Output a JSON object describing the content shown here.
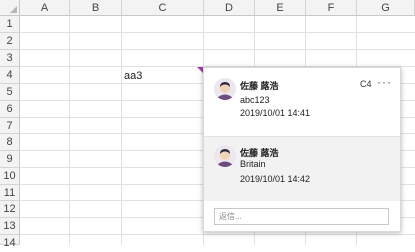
{
  "columns": [
    "A",
    "B",
    "C",
    "D",
    "E",
    "F",
    "G"
  ],
  "rows": [
    "1",
    "2",
    "3",
    "4",
    "5",
    "6",
    "7",
    "8",
    "9",
    "10",
    "11",
    "12",
    "13",
    "14"
  ],
  "cells": {
    "C4": "aa3"
  },
  "comment_panel": {
    "cell_ref": "C4",
    "more": "···",
    "threads": [
      {
        "author": "佐藤 蕗浩",
        "text": "abc123",
        "timestamp": "2019/10/01 14:41"
      },
      {
        "author": "佐藤 蕗浩",
        "text": "Britain",
        "timestamp": "2019/10/01 14:42"
      }
    ],
    "reply_placeholder": "返信..."
  },
  "colors": {
    "comment_marker": "#a83aa6"
  }
}
